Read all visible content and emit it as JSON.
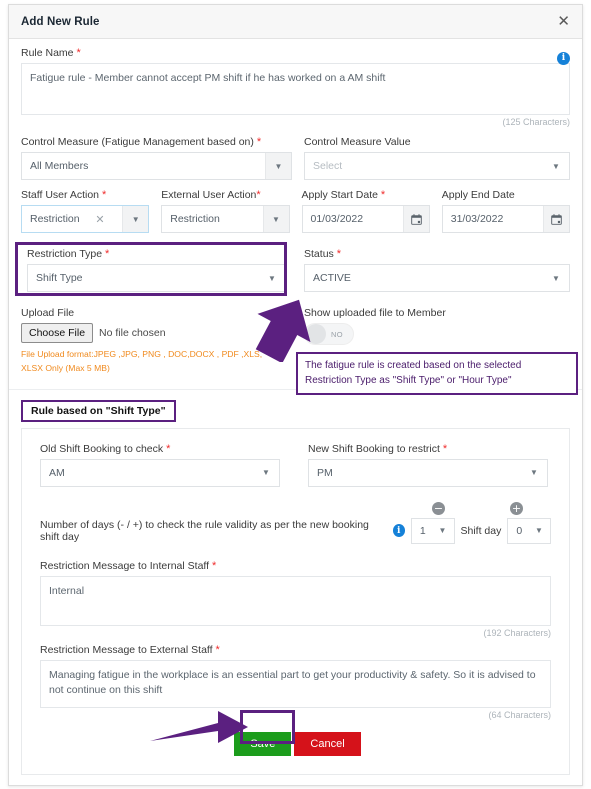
{
  "modal": {
    "title": "Add New Rule",
    "close_icon": "close-icon",
    "header_info_icon": "info-icon"
  },
  "rule_name": {
    "label": "Rule Name",
    "required": true,
    "value": "Fatigue rule - Member cannot accept PM shift if he has worked on a AM shift",
    "counter": "(125 Characters)"
  },
  "control_measure": {
    "label": "Control Measure (Fatigue Management based on)",
    "required": true,
    "value": "All Members"
  },
  "control_measure_value": {
    "label": "Control Measure Value",
    "required": false,
    "placeholder": "Select"
  },
  "staff_user_action": {
    "label": "Staff User Action",
    "required": true,
    "value": "Restriction",
    "clear_icon": "clear-icon"
  },
  "external_user_action": {
    "label": "External User Action",
    "required": true,
    "value": "Restriction"
  },
  "apply_start_date": {
    "label": "Apply Start Date",
    "required": true,
    "value": "01/03/2022",
    "icon": "calendar-icon"
  },
  "apply_end_date": {
    "label": "Apply End Date",
    "required": false,
    "value": "31/03/2022",
    "icon": "calendar-icon"
  },
  "restriction_type": {
    "label": "Restriction Type",
    "required": true,
    "value": "Shift Type"
  },
  "status": {
    "label": "Status",
    "required": true,
    "value": "ACTIVE"
  },
  "upload_file": {
    "label": "Upload File",
    "button_label": "Choose File",
    "no_file_text": "No file chosen",
    "format_note": "File Upload format:JPEG ,JPG, PNG , DOC,DOCX , PDF ,XLS, XLSX Only (Max 5 MB)"
  },
  "show_uploaded": {
    "label": "Show uploaded file to Member",
    "toggle_state": "NO"
  },
  "annotation": {
    "callout_text": "The fatigue rule is created based on the selected Restriction Type as \"Shift Type\" or \"Hour Type\"",
    "highlight_color": "#5b2080"
  },
  "section": {
    "heading": "Rule based on \"Shift Type\""
  },
  "old_shift_booking": {
    "label": "Old Shift Booking to check",
    "required": true,
    "value": "AM"
  },
  "new_shift_booking": {
    "label": "New Shift Booking to restrict",
    "required": true,
    "value": "PM"
  },
  "days_rule": {
    "label": "Number of days (- / +) to check the rule validity as per the new booking shift day",
    "info_icon": "info-icon",
    "minus_icon": "minus-circle-icon",
    "plus_icon": "plus-circle-icon",
    "days_value": "1",
    "shift_day_label": "Shift day",
    "shift_day_value": "0"
  },
  "internal_message": {
    "label": "Restriction Message to Internal Staff",
    "required": true,
    "value": "Internal",
    "counter": "(192 Characters)"
  },
  "external_message": {
    "label": "Restriction Message to External Staff",
    "required": true,
    "value": "Managing fatigue in the workplace is an essential part to get your productivity & safety. So it is advised to not continue on this shift",
    "counter": "(64 Characters)"
  },
  "footer": {
    "save_label": "Save",
    "cancel_label": "Cancel",
    "save_color": "#1c9c1c",
    "cancel_color": "#d5121a"
  }
}
